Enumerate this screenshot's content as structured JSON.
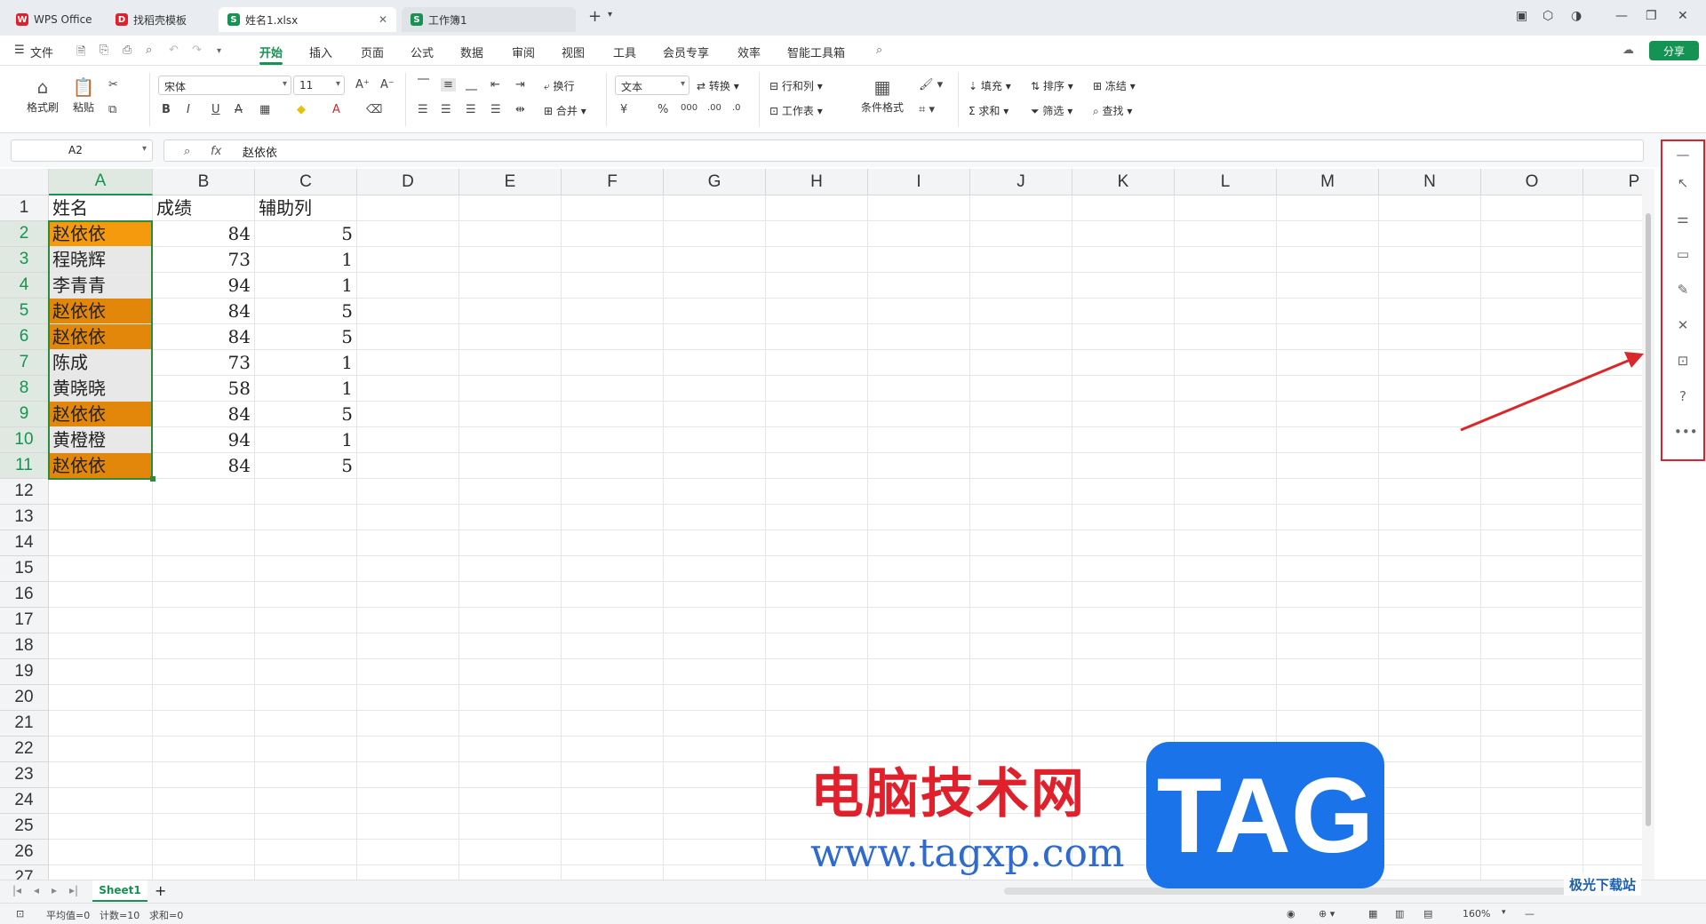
{
  "tabs": [
    {
      "label": "WPS Office",
      "icon": "W",
      "color": "#e0202a"
    },
    {
      "label": "找稻壳模板",
      "icon": "D",
      "color": "#e0202a"
    },
    {
      "label": "姓名1.xlsx",
      "icon": "S",
      "color": "#149352"
    },
    {
      "label": "工作簿1",
      "icon": "S",
      "color": "#149352"
    }
  ],
  "menu": {
    "file": "文件",
    "items": [
      "开始",
      "插入",
      "页面",
      "公式",
      "数据",
      "审阅",
      "视图",
      "工具",
      "会员专享",
      "效率",
      "智能工具箱"
    ],
    "active": "开始",
    "share": "分享"
  },
  "ribbon": {
    "format_painter": "格式刷",
    "paste": "粘贴",
    "font": "宋体",
    "font_size": "11",
    "wrap": "换行",
    "merge": "合并",
    "number_format": "文本",
    "convert": "转换",
    "row_col": "行和列",
    "worksheet": "工作表",
    "cond_format": "条件格式",
    "fill": "填充",
    "sort": "排序",
    "freeze": "冻结",
    "sum": "求和",
    "filter": "筛选",
    "find": "查找"
  },
  "formula_bar": {
    "namebox": "A2",
    "fx": "fx",
    "value": "赵依依"
  },
  "columns": [
    "A",
    "B",
    "C",
    "D",
    "E",
    "F",
    "G",
    "H",
    "I",
    "J",
    "K",
    "L",
    "M",
    "N",
    "O",
    "P"
  ],
  "rows": [
    "1",
    "2",
    "3",
    "4",
    "5",
    "6",
    "7",
    "8",
    "9",
    "10",
    "11",
    "12",
    "13",
    "14",
    "15",
    "16",
    "17",
    "18",
    "19",
    "20",
    "21",
    "22",
    "23",
    "24",
    "25",
    "26",
    "27"
  ],
  "sheet": {
    "header": [
      "姓名",
      "成绩",
      "辅助列"
    ],
    "data": [
      {
        "name": "赵依依",
        "score": "84",
        "aux": "5",
        "highlight": true
      },
      {
        "name": "程晓辉",
        "score": "73",
        "aux": "1",
        "highlight": false
      },
      {
        "name": "李青青",
        "score": "94",
        "aux": "1",
        "highlight": false
      },
      {
        "name": "赵依依",
        "score": "84",
        "aux": "5",
        "highlight": true
      },
      {
        "name": "赵依依",
        "score": "84",
        "aux": "5",
        "highlight": true
      },
      {
        "name": "陈成",
        "score": "73",
        "aux": "1",
        "highlight": false
      },
      {
        "name": "黄晓晓",
        "score": "58",
        "aux": "1",
        "highlight": false
      },
      {
        "name": "赵依依",
        "score": "84",
        "aux": "5",
        "highlight": true
      },
      {
        "name": "黄橙橙",
        "score": "94",
        "aux": "1",
        "highlight": false
      },
      {
        "name": "赵依依",
        "score": "84",
        "aux": "5",
        "highlight": true
      }
    ],
    "highlight_color": "#e3870a",
    "first_highlight_color": "#f59a0c",
    "selected_gray": "#e8e8e8"
  },
  "sheet_tab": "Sheet1",
  "status": {
    "average": "平均值=0",
    "count": "计数=10",
    "sum": "求和=0",
    "zoom": "160%"
  },
  "watermark": {
    "line1": "电脑技术网",
    "line2": "www.tagxp.com",
    "tag": "TAG",
    "corner": "极光下载站"
  },
  "colors": {
    "accent": "#149352",
    "highlight_box": "#e0202a"
  }
}
